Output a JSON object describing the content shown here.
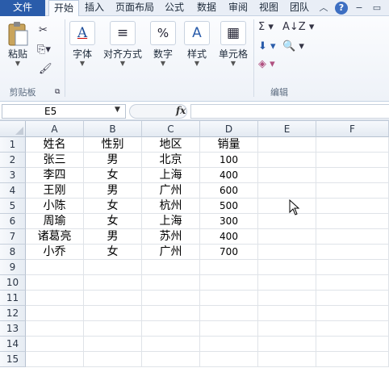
{
  "tabs": {
    "file": "文件",
    "home": "开始",
    "insert": "插入",
    "layout": "页面布局",
    "formulas": "公式",
    "data": "数据",
    "review": "审阅",
    "view": "视图",
    "team": "团队"
  },
  "title_icons": {
    "collapse": "chevron-up-icon",
    "help": "?",
    "minimize": "−",
    "restore": "▭"
  },
  "ribbon": {
    "paste": "粘贴",
    "clipboard_group": "剪贴板",
    "font": "字体",
    "alignment": "对齐方式",
    "number": "数字",
    "styles": "样式",
    "cells": "单元格",
    "editing_group": "编辑"
  },
  "formula_bar": {
    "name_box": "E5",
    "fx": "fx",
    "formula": ""
  },
  "columns": [
    "A",
    "B",
    "C",
    "D",
    "E",
    "F"
  ],
  "rows": [
    "1",
    "2",
    "3",
    "4",
    "5",
    "6",
    "7",
    "8",
    "9",
    "10",
    "11",
    "12",
    "13",
    "14",
    "15"
  ],
  "table": {
    "header": [
      "姓名",
      "性别",
      "地区",
      "销量"
    ],
    "data": [
      [
        "张三",
        "男",
        "北京",
        "100"
      ],
      [
        "李四",
        "女",
        "上海",
        "400"
      ],
      [
        "王刚",
        "男",
        "广州",
        "600"
      ],
      [
        "小陈",
        "女",
        "杭州",
        "500"
      ],
      [
        "周瑜",
        "女",
        "上海",
        "300"
      ],
      [
        "诸葛亮",
        "男",
        "苏州",
        "400"
      ],
      [
        "小乔",
        "女",
        "广州",
        "700"
      ]
    ]
  },
  "colors": {
    "file_tab": "#2a5caa",
    "ribbon_bg": "#eef2f8",
    "header_bg": "#e4eaf2"
  }
}
